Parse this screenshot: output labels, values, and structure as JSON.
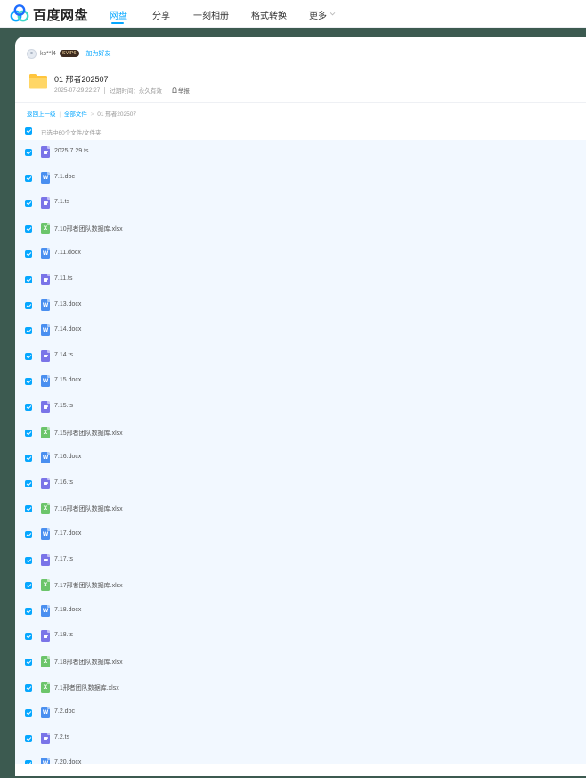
{
  "brand": {
    "name": "百度网盘"
  },
  "nav": {
    "items": [
      {
        "label": "网盘",
        "active": true
      },
      {
        "label": "分享",
        "active": false
      },
      {
        "label": "一刻相册",
        "active": false
      },
      {
        "label": "格式转换",
        "active": false
      },
      {
        "label": "更多",
        "active": false
      }
    ]
  },
  "share": {
    "owner_name": "ks**l4",
    "vip_badge": "SVIP6",
    "add_friend_label": "加为好友",
    "folder_title": "01 邢者202507",
    "created_at": "2025-07-29 22:27",
    "expire_label": "过期时间：永久有效",
    "report_label": "举报"
  },
  "breadcrumb": {
    "back_label": "返回上一级",
    "all_files_label": "全部文件",
    "separator": ">",
    "current": "01 邢者202507"
  },
  "selection": {
    "summary": "已选中60个文件/文件夹"
  },
  "files": [
    {
      "name": "2025.7.29.ts",
      "type": "video"
    },
    {
      "name": "7.1.doc",
      "type": "word"
    },
    {
      "name": "7.1.ts",
      "type": "video"
    },
    {
      "name": "7.10邢者团队数据库.xlsx",
      "type": "excel"
    },
    {
      "name": "7.11.docx",
      "type": "word"
    },
    {
      "name": "7.11.ts",
      "type": "video"
    },
    {
      "name": "7.13.docx",
      "type": "word"
    },
    {
      "name": "7.14.docx",
      "type": "word"
    },
    {
      "name": "7.14.ts",
      "type": "video"
    },
    {
      "name": "7.15.docx",
      "type": "word"
    },
    {
      "name": "7.15.ts",
      "type": "video"
    },
    {
      "name": "7.15邢者团队数据库.xlsx",
      "type": "excel"
    },
    {
      "name": "7.16.docx",
      "type": "word"
    },
    {
      "name": "7.16.ts",
      "type": "video"
    },
    {
      "name": "7.16邢者团队数据库.xlsx",
      "type": "excel"
    },
    {
      "name": "7.17.docx",
      "type": "word"
    },
    {
      "name": "7.17.ts",
      "type": "video"
    },
    {
      "name": "7.17邢者团队数据库.xlsx",
      "type": "excel"
    },
    {
      "name": "7.18.docx",
      "type": "word"
    },
    {
      "name": "7.18.ts",
      "type": "video"
    },
    {
      "name": "7.18邢者团队数据库.xlsx",
      "type": "excel"
    },
    {
      "name": "7.1邢者团队数据库.xlsx",
      "type": "excel"
    },
    {
      "name": "7.2.doc",
      "type": "word"
    },
    {
      "name": "7.2.ts",
      "type": "video"
    },
    {
      "name": "7.20.docx",
      "type": "word"
    }
  ],
  "icons": {
    "video": "video-file-icon",
    "word": "word-file-icon",
    "excel": "excel-file-icon",
    "folder": "folder-icon",
    "report": "report-icon",
    "chevron": "chevron-down-icon",
    "logo": "baidu-netdisk-logo-icon"
  },
  "colors": {
    "accent": "#06a7ff",
    "backdrop": "#3c5a50",
    "list_bg": "#f2f8ff",
    "video": "#7a74e8",
    "word": "#4a8ff0",
    "excel": "#6cc56b",
    "folder": "#ffc53d"
  }
}
